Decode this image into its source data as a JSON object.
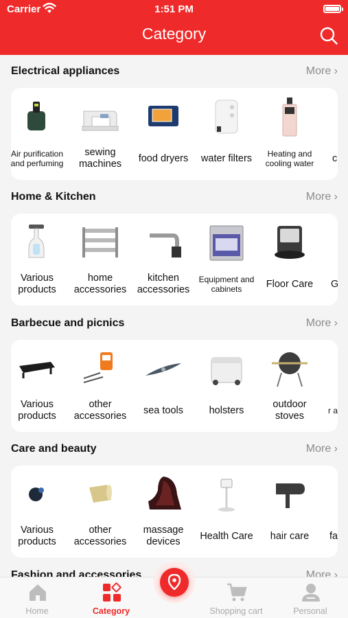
{
  "status_bar": {
    "carrier": "Carrier",
    "time": "1:51 PM"
  },
  "header": {
    "title": "Category",
    "search_icon": "search-icon"
  },
  "colors": {
    "brand": "#ee2a2a",
    "more_text": "#8c8c8c",
    "tab_inactive": "#a9a9a9"
  },
  "sections": [
    {
      "title": "Electrical appliances",
      "more": "More",
      "items": [
        {
          "label": "Air purification and perfuming",
          "small": true,
          "icon": "air-purifier"
        },
        {
          "label": "sewing machines",
          "small": false,
          "icon": "sewing-machine"
        },
        {
          "label": "food dryers",
          "small": false,
          "icon": "food-dryer"
        },
        {
          "label": "water filters",
          "small": false,
          "icon": "water-filter"
        },
        {
          "label": "Heating and cooling water",
          "small": true,
          "icon": "water-dispenser"
        },
        {
          "label": "c b",
          "small": false,
          "icon": "partial-item"
        }
      ]
    },
    {
      "title": "Home & Kitchen",
      "more": "More",
      "items": [
        {
          "label": "Various products",
          "small": false,
          "icon": "steam-cleaner"
        },
        {
          "label": "home accessories",
          "small": false,
          "icon": "towel-rack"
        },
        {
          "label": "kitchen accessories",
          "small": false,
          "icon": "kitchen-faucet"
        },
        {
          "label": "Equipment and cabinets",
          "small": true,
          "icon": "oven-range"
        },
        {
          "label": "Floor Care",
          "small": false,
          "icon": "robot-vacuum"
        },
        {
          "label": "G",
          "small": false,
          "icon": "partial-item"
        }
      ]
    },
    {
      "title": "Barbecue and picnics",
      "more": "More",
      "items": [
        {
          "label": "Various products",
          "small": false,
          "icon": "griddle"
        },
        {
          "label": "other accessories",
          "small": false,
          "icon": "bbq-thermometer"
        },
        {
          "label": "sea tools",
          "small": false,
          "icon": "kayak"
        },
        {
          "label": "holsters",
          "small": false,
          "icon": "cooler-box"
        },
        {
          "label": "outdoor stoves",
          "small": false,
          "icon": "kamado-grill"
        },
        {
          "label": "r and",
          "small": true,
          "icon": "partial-item"
        }
      ]
    },
    {
      "title": "Care and beauty",
      "more": "More",
      "items": [
        {
          "label": "Various products",
          "small": false,
          "icon": "beauty-device"
        },
        {
          "label": "other accessories",
          "small": false,
          "icon": "sponge-roll"
        },
        {
          "label": "massage devices",
          "small": false,
          "icon": "massage-chair"
        },
        {
          "label": "Health Care",
          "small": false,
          "icon": "health-device"
        },
        {
          "label": "hair care",
          "small": false,
          "icon": "hair-dryer"
        },
        {
          "label": "fa",
          "small": false,
          "icon": "partial-item"
        }
      ]
    },
    {
      "title": "Fashion and accessories",
      "more": "More",
      "items": []
    }
  ],
  "tabbar": {
    "tabs": [
      {
        "label": "Home",
        "icon": "home-icon",
        "active": false
      },
      {
        "label": "Category",
        "icon": "category-icon",
        "active": true
      },
      {
        "label": "Shopping cart",
        "icon": "cart-icon",
        "active": false
      },
      {
        "label": "Personal",
        "icon": "person-icon",
        "active": false
      }
    ],
    "center_button_icon": "location-pin-icon"
  }
}
